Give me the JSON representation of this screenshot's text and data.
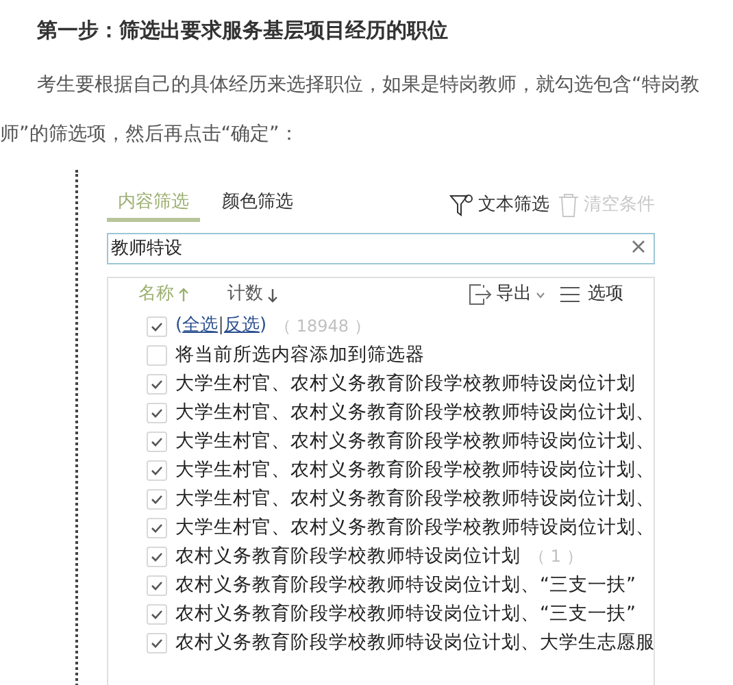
{
  "heading": "第一步：筛选出要求服务基层项目经历的职位",
  "paragraph": "考生要根据自己的具体经历来选择职位，如果是特岗教师，就勾选包含“特岗教师”的筛选项，然后再点击“确定”：",
  "tabs": [
    {
      "label": "内容筛选",
      "selected": true
    },
    {
      "label": "颜色筛选",
      "selected": false
    }
  ],
  "toolbar": [
    {
      "label": "文本筛选",
      "disabled": false
    },
    {
      "label": "清空条件",
      "disabled": true
    }
  ],
  "search": {
    "value": "教师特设"
  },
  "list_header": {
    "sort_name": "名称",
    "sort_count": "计数",
    "export": "导出",
    "options": "选项"
  },
  "items": [
    {
      "kind": "select_all",
      "checked": true,
      "open": "(",
      "link_all": "全选",
      "separator": "|",
      "link_invert": "反选",
      "close": ")",
      "count": "（ 18948 ）"
    },
    {
      "kind": "add",
      "checked": false,
      "label": "将当前所选内容添加到筛选器"
    },
    {
      "kind": "value",
      "checked": true,
      "label": "大学生村官、农村义务教育阶段学校教师特设岗位计划"
    },
    {
      "kind": "value",
      "checked": true,
      "label": "大学生村官、农村义务教育阶段学校教师特设岗位计划、"
    },
    {
      "kind": "value",
      "checked": true,
      "label": "大学生村官、农村义务教育阶段学校教师特设岗位计划、"
    },
    {
      "kind": "value",
      "checked": true,
      "label": "大学生村官、农村义务教育阶段学校教师特设岗位计划、"
    },
    {
      "kind": "value",
      "checked": true,
      "label": "大学生村官、农村义务教育阶段学校教师特设岗位计划、"
    },
    {
      "kind": "value",
      "checked": true,
      "label": "大学生村官、农村义务教育阶段学校教师特设岗位计划、"
    },
    {
      "kind": "value",
      "checked": true,
      "label": "农村义务教育阶段学校教师特设岗位计划",
      "count": "（ 1 ）"
    },
    {
      "kind": "value",
      "checked": true,
      "label": "农村义务教育阶段学校教师特设岗位计划、“三支一扶”"
    },
    {
      "kind": "value",
      "checked": true,
      "label": "农村义务教育阶段学校教师特设岗位计划、“三支一扶”"
    },
    {
      "kind": "value",
      "checked": true,
      "label": "农村义务教育阶段学校教师特设岗位计划、大学生志愿服"
    }
  ]
}
